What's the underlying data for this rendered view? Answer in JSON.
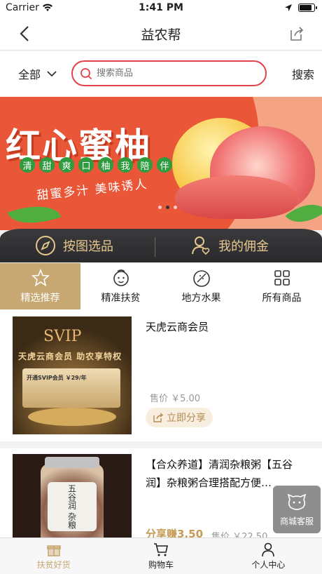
{
  "status_bar": {
    "carrier": "Carrier",
    "time": "1:41 PM",
    "battery_level": 0.9
  },
  "nav": {
    "title": "益农帮"
  },
  "search": {
    "category": "全部",
    "placeholder": "搜索商品",
    "button": "搜索"
  },
  "banner": {
    "headline": "红心蜜柚",
    "tags": [
      "清",
      "甜",
      "爽",
      "口",
      "柚",
      "我",
      "陪",
      "伴"
    ],
    "slogan": "甜蜜多汁  美味诱人",
    "active_slide": 2,
    "slide_count": 3
  },
  "quick_actions": [
    {
      "label": "按图选品",
      "icon": "compass-icon"
    },
    {
      "label": "我的佣金",
      "icon": "user-heart-icon"
    }
  ],
  "tabs": [
    {
      "label": "精选推荐",
      "icon": "star-icon",
      "active": true
    },
    {
      "label": "精准扶贫",
      "icon": "face-icon",
      "active": false
    },
    {
      "label": "地方水果",
      "icon": "fruit-icon",
      "active": false
    },
    {
      "label": "所有商品",
      "icon": "grid-icon",
      "active": false
    }
  ],
  "products": [
    {
      "name": "天虎云商会员",
      "price": "售价 ￥5.00",
      "share_button": "立即分享",
      "image": {
        "logo": "SVIP",
        "title": "天虎云商会员 助农享特权",
        "card_lines": [
          "开通SVIP会员 ￥29/年"
        ]
      }
    },
    {
      "name": "【合众养道】清润杂粮粥【五谷润】杂粮粥合理搭配方便…",
      "earn": "分享赚3.50",
      "price": "售价 ￥22.50",
      "image": {
        "label": "五谷润 杂粮"
      }
    }
  ],
  "customer_service": {
    "label": "商城客服"
  },
  "tab_bar": [
    {
      "label": "扶贫好货",
      "icon": "gift-icon",
      "active": true
    },
    {
      "label": "购物车",
      "icon": "cart-icon",
      "active": false
    },
    {
      "label": "个人中心",
      "icon": "person-icon",
      "active": false
    }
  ],
  "colors": {
    "accent_gold": "#c8a872",
    "search_border": "#e2434a",
    "banner_red": "#ea5638"
  }
}
